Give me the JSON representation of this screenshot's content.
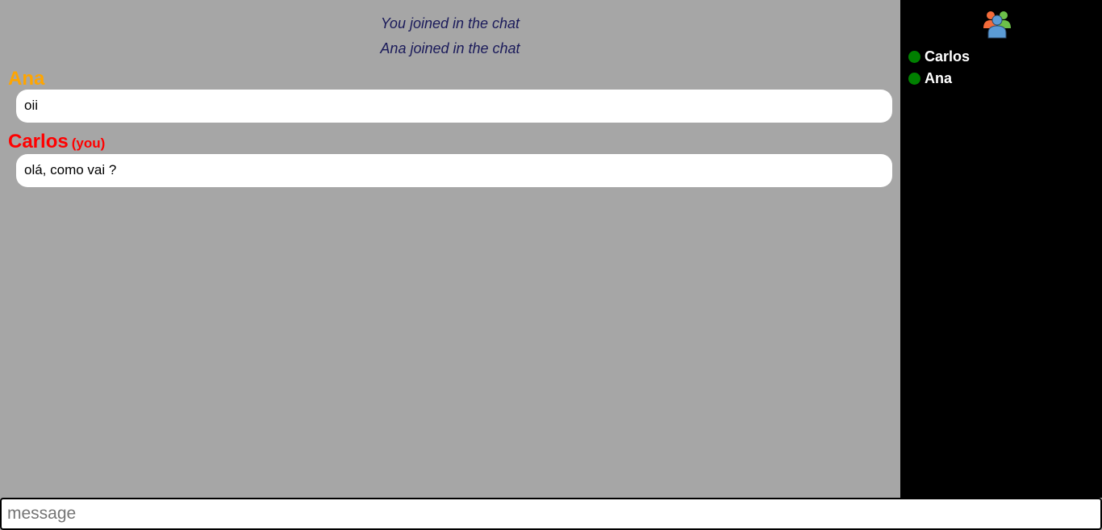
{
  "chat": {
    "system_messages": [
      "You joined in the chat",
      "Ana joined in the chat"
    ],
    "messages": [
      {
        "author": "Ana",
        "author_color": "#ffa500",
        "is_you": false,
        "text": "oii"
      },
      {
        "author": "Carlos",
        "author_color": "#ff0000",
        "is_you": true,
        "you_label": "(you)",
        "text": "olá, como vai ?"
      }
    ]
  },
  "sidebar": {
    "icon": "users-group-icon",
    "online_color": "#008000",
    "users": [
      {
        "name": "Carlos",
        "status": "online"
      },
      {
        "name": "Ana",
        "status": "online"
      }
    ]
  },
  "input": {
    "placeholder": "message",
    "value": ""
  }
}
